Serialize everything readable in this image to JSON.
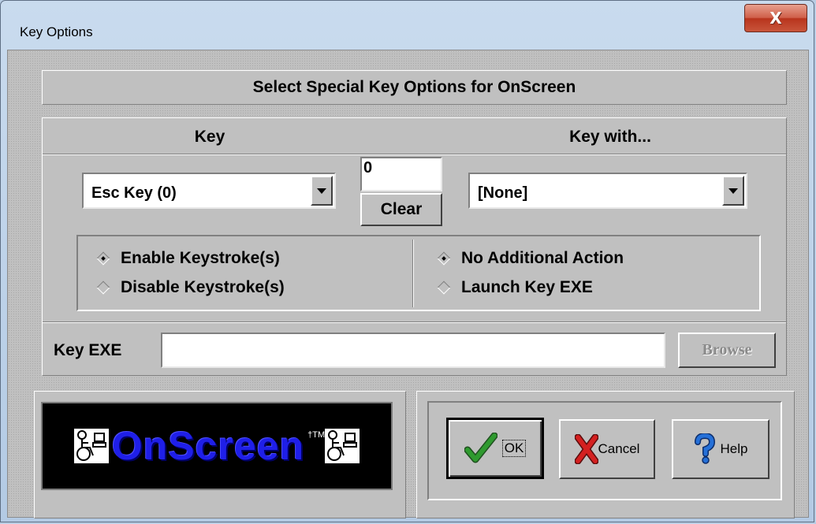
{
  "window": {
    "title": "Key Options",
    "close_symbol": "X"
  },
  "header": {
    "title": "Select Special Key Options for OnScreen"
  },
  "key_section": {
    "key_header": "Key",
    "key_with_header": "Key with...",
    "key_select": "Esc Key (0)",
    "key_code": "0",
    "clear_label": "Clear",
    "key_with_select": "[None]"
  },
  "radios": {
    "enable": "Enable Keystroke(s)",
    "disable": "Disable Keystroke(s)",
    "enable_selected": true,
    "no_action": "No Additional Action",
    "launch_exe": "Launch Key EXE",
    "no_action_selected": true
  },
  "exe": {
    "label": "Key EXE",
    "value": "",
    "browse_label": "Browse"
  },
  "logo": {
    "text": "OnScreen",
    "tm": "†TM"
  },
  "buttons": {
    "ok": "OK",
    "cancel": "Cancel",
    "help": "Help"
  },
  "colors": {
    "logo_text": "#1f1fe8",
    "ok_check": "#2f9a2f",
    "cancel_x": "#d42020",
    "help_q": "#2570d8"
  }
}
